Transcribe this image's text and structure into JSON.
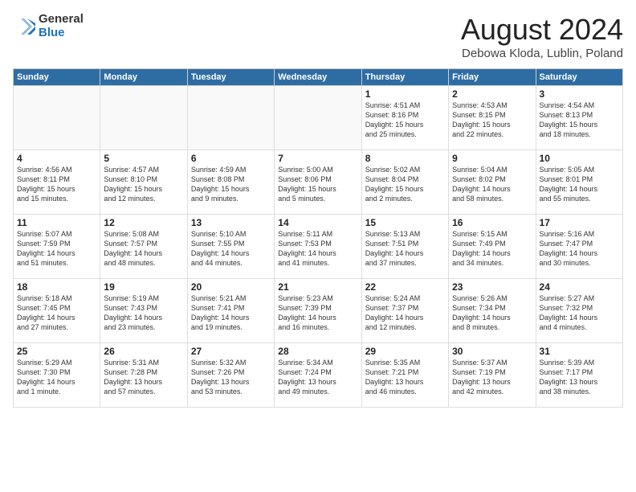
{
  "header": {
    "logo_general": "General",
    "logo_blue": "Blue",
    "month_title": "August 2024",
    "location": "Debowa Kloda, Lublin, Poland"
  },
  "weekdays": [
    "Sunday",
    "Monday",
    "Tuesday",
    "Wednesday",
    "Thursday",
    "Friday",
    "Saturday"
  ],
  "weeks": [
    [
      {
        "day": "",
        "info": ""
      },
      {
        "day": "",
        "info": ""
      },
      {
        "day": "",
        "info": ""
      },
      {
        "day": "",
        "info": ""
      },
      {
        "day": "1",
        "info": "Sunrise: 4:51 AM\nSunset: 8:16 PM\nDaylight: 15 hours\nand 25 minutes."
      },
      {
        "day": "2",
        "info": "Sunrise: 4:53 AM\nSunset: 8:15 PM\nDaylight: 15 hours\nand 22 minutes."
      },
      {
        "day": "3",
        "info": "Sunrise: 4:54 AM\nSunset: 8:13 PM\nDaylight: 15 hours\nand 18 minutes."
      }
    ],
    [
      {
        "day": "4",
        "info": "Sunrise: 4:56 AM\nSunset: 8:11 PM\nDaylight: 15 hours\nand 15 minutes."
      },
      {
        "day": "5",
        "info": "Sunrise: 4:57 AM\nSunset: 8:10 PM\nDaylight: 15 hours\nand 12 minutes."
      },
      {
        "day": "6",
        "info": "Sunrise: 4:59 AM\nSunset: 8:08 PM\nDaylight: 15 hours\nand 9 minutes."
      },
      {
        "day": "7",
        "info": "Sunrise: 5:00 AM\nSunset: 8:06 PM\nDaylight: 15 hours\nand 5 minutes."
      },
      {
        "day": "8",
        "info": "Sunrise: 5:02 AM\nSunset: 8:04 PM\nDaylight: 15 hours\nand 2 minutes."
      },
      {
        "day": "9",
        "info": "Sunrise: 5:04 AM\nSunset: 8:02 PM\nDaylight: 14 hours\nand 58 minutes."
      },
      {
        "day": "10",
        "info": "Sunrise: 5:05 AM\nSunset: 8:01 PM\nDaylight: 14 hours\nand 55 minutes."
      }
    ],
    [
      {
        "day": "11",
        "info": "Sunrise: 5:07 AM\nSunset: 7:59 PM\nDaylight: 14 hours\nand 51 minutes."
      },
      {
        "day": "12",
        "info": "Sunrise: 5:08 AM\nSunset: 7:57 PM\nDaylight: 14 hours\nand 48 minutes."
      },
      {
        "day": "13",
        "info": "Sunrise: 5:10 AM\nSunset: 7:55 PM\nDaylight: 14 hours\nand 44 minutes."
      },
      {
        "day": "14",
        "info": "Sunrise: 5:11 AM\nSunset: 7:53 PM\nDaylight: 14 hours\nand 41 minutes."
      },
      {
        "day": "15",
        "info": "Sunrise: 5:13 AM\nSunset: 7:51 PM\nDaylight: 14 hours\nand 37 minutes."
      },
      {
        "day": "16",
        "info": "Sunrise: 5:15 AM\nSunset: 7:49 PM\nDaylight: 14 hours\nand 34 minutes."
      },
      {
        "day": "17",
        "info": "Sunrise: 5:16 AM\nSunset: 7:47 PM\nDaylight: 14 hours\nand 30 minutes."
      }
    ],
    [
      {
        "day": "18",
        "info": "Sunrise: 5:18 AM\nSunset: 7:45 PM\nDaylight: 14 hours\nand 27 minutes."
      },
      {
        "day": "19",
        "info": "Sunrise: 5:19 AM\nSunset: 7:43 PM\nDaylight: 14 hours\nand 23 minutes."
      },
      {
        "day": "20",
        "info": "Sunrise: 5:21 AM\nSunset: 7:41 PM\nDaylight: 14 hours\nand 19 minutes."
      },
      {
        "day": "21",
        "info": "Sunrise: 5:23 AM\nSunset: 7:39 PM\nDaylight: 14 hours\nand 16 minutes."
      },
      {
        "day": "22",
        "info": "Sunrise: 5:24 AM\nSunset: 7:37 PM\nDaylight: 14 hours\nand 12 minutes."
      },
      {
        "day": "23",
        "info": "Sunrise: 5:26 AM\nSunset: 7:34 PM\nDaylight: 14 hours\nand 8 minutes."
      },
      {
        "day": "24",
        "info": "Sunrise: 5:27 AM\nSunset: 7:32 PM\nDaylight: 14 hours\nand 4 minutes."
      }
    ],
    [
      {
        "day": "25",
        "info": "Sunrise: 5:29 AM\nSunset: 7:30 PM\nDaylight: 14 hours\nand 1 minute."
      },
      {
        "day": "26",
        "info": "Sunrise: 5:31 AM\nSunset: 7:28 PM\nDaylight: 13 hours\nand 57 minutes."
      },
      {
        "day": "27",
        "info": "Sunrise: 5:32 AM\nSunset: 7:26 PM\nDaylight: 13 hours\nand 53 minutes."
      },
      {
        "day": "28",
        "info": "Sunrise: 5:34 AM\nSunset: 7:24 PM\nDaylight: 13 hours\nand 49 minutes."
      },
      {
        "day": "29",
        "info": "Sunrise: 5:35 AM\nSunset: 7:21 PM\nDaylight: 13 hours\nand 46 minutes."
      },
      {
        "day": "30",
        "info": "Sunrise: 5:37 AM\nSunset: 7:19 PM\nDaylight: 13 hours\nand 42 minutes."
      },
      {
        "day": "31",
        "info": "Sunrise: 5:39 AM\nSunset: 7:17 PM\nDaylight: 13 hours\nand 38 minutes."
      }
    ]
  ]
}
